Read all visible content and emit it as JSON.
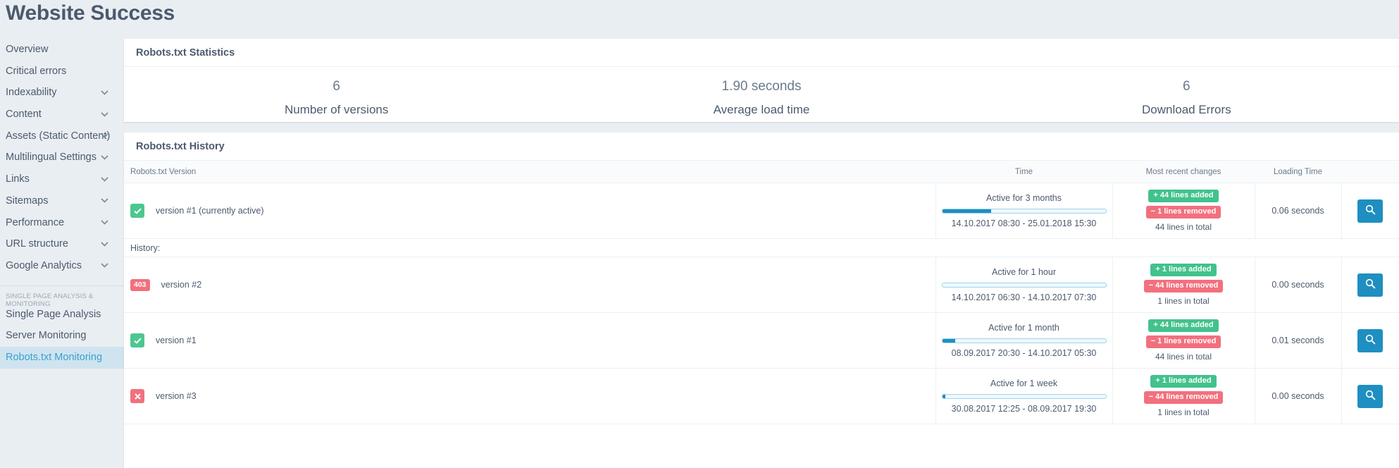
{
  "header": {
    "title": "Website Success"
  },
  "sidebar": {
    "items": [
      {
        "label": "Overview",
        "chevron": false,
        "active": false
      },
      {
        "label": "Critical errors",
        "chevron": false,
        "active": false
      },
      {
        "label": "Indexability",
        "chevron": true,
        "active": false
      },
      {
        "label": "Content",
        "chevron": true,
        "active": false
      },
      {
        "label": "Assets (Static Content)",
        "chevron": true,
        "active": false
      },
      {
        "label": "Multilingual Settings",
        "chevron": true,
        "active": false
      },
      {
        "label": "Links",
        "chevron": true,
        "active": false
      },
      {
        "label": "Sitemaps",
        "chevron": true,
        "active": false
      },
      {
        "label": "Performance",
        "chevron": true,
        "active": false
      },
      {
        "label": "URL structure",
        "chevron": true,
        "active": false
      },
      {
        "label": "Google Analytics",
        "chevron": true,
        "active": false
      }
    ],
    "section_label": "SINGLE PAGE ANALYSIS & MONITORING",
    "section_items": [
      {
        "label": "Single Page Analysis",
        "active": false
      },
      {
        "label": "Server Monitoring",
        "active": false
      },
      {
        "label": "Robots.txt Monitoring",
        "active": true
      }
    ],
    "active_bg": "#cfe4ef",
    "active_color": "#3aa0d1"
  },
  "stats_card": {
    "title": "Robots.txt Statistics",
    "stats": [
      {
        "value": "6",
        "label": "Number of versions"
      },
      {
        "value": "1.90 seconds",
        "label": "Average load time"
      },
      {
        "value": "6",
        "label": "Download Errors"
      }
    ]
  },
  "history_card": {
    "title": "Robots.txt History",
    "columns": {
      "version": "Robots.txt Version",
      "time": "Time",
      "changes": "Most recent changes",
      "loading": "Loading Time",
      "action": ""
    },
    "history_label": "History:",
    "action_icon": "search-icon",
    "rows": [
      {
        "status_icon": "check-icon",
        "status_type": "ok",
        "status_code": "",
        "version": "version #1 (currently active)",
        "duration": "Active for 3 months",
        "bar_percent": 30,
        "range": "14.10.2017 08:30 - 25.01.2018 15:30",
        "added": "+ 44 lines added",
        "removed": "− 1 lines removed",
        "total": "44 lines in total",
        "loading": "0.06 seconds"
      },
      {
        "status_icon": "http-status-badge",
        "status_type": "code",
        "status_code": "403",
        "version": "version #2",
        "duration": "Active for 1 hour",
        "bar_percent": 0,
        "range": "14.10.2017 06:30 - 14.10.2017 07:30",
        "added": "+ 1 lines added",
        "removed": "− 44 lines removed",
        "total": "1 lines in total",
        "loading": "0.00 seconds"
      },
      {
        "status_icon": "check-icon",
        "status_type": "ok",
        "status_code": "",
        "version": "version #1",
        "duration": "Active for 1 month",
        "bar_percent": 8,
        "range": "08.09.2017 20:30 - 14.10.2017 05:30",
        "added": "+ 44 lines added",
        "removed": "− 1 lines removed",
        "total": "44 lines in total",
        "loading": "0.01 seconds"
      },
      {
        "status_icon": "cross-icon",
        "status_type": "bad",
        "status_code": "",
        "version": "version #3",
        "duration": "Active for 1 week",
        "bar_percent": 2,
        "range": "30.08.2017 12:25 - 08.09.2017 19:30",
        "added": "+ 1 lines added",
        "removed": "− 44 lines removed",
        "total": "1 lines in total",
        "loading": "0.00 seconds"
      }
    ]
  },
  "colors": {
    "page_bg": "#e9eef2",
    "accent_blue": "#1e8fc0",
    "green": "#42c28c",
    "red": "#f2707e",
    "text": "#4c5a6e"
  }
}
